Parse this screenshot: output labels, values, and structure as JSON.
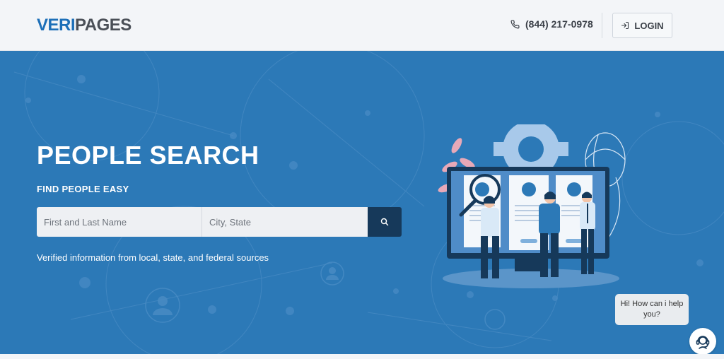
{
  "header": {
    "logo_part1": "VERI",
    "logo_part2": "PAGES",
    "phone": "(844) 217-0978",
    "phone_icon": "phone-icon",
    "login_label": "LOGIN",
    "login_icon": "login-icon"
  },
  "hero": {
    "title": "PEOPLE SEARCH",
    "subtitle": "FIND PEOPLE EASY",
    "search": {
      "name_placeholder": "First and Last Name",
      "name_value": "",
      "city_placeholder": "City, State",
      "city_value": "",
      "button_icon": "search-icon"
    },
    "tagline": "Verified information from local, state, and federal sources"
  },
  "chat": {
    "message": "Hi! How can i help you?",
    "avatar_icon": "support-agent-icon"
  },
  "colors": {
    "brand_blue": "#1d6fb8",
    "hero_bg": "#2c79b7",
    "search_button": "#16395a"
  }
}
